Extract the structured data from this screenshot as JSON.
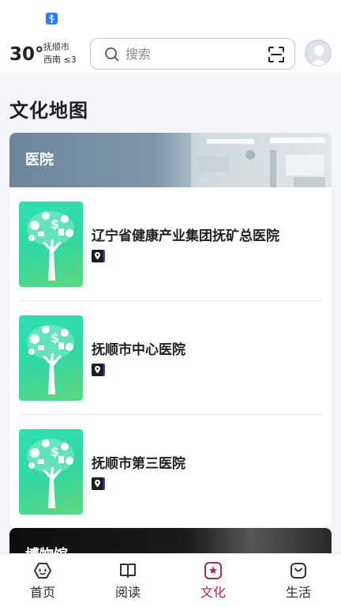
{
  "status_bar": {
    "icon": "usb-icon"
  },
  "header": {
    "temperature": "30°",
    "city": "抚顺市",
    "wind": "西南 ≤3",
    "search_placeholder": "搜索",
    "icons": [
      "search-icon",
      "scan-icon",
      "avatar"
    ]
  },
  "page_title": "文化地图",
  "category": {
    "title": "医院",
    "items": [
      {
        "name": "辽宁省健康产业集团抚矿总医院",
        "icon": "location-icon"
      },
      {
        "name": "抚顺市中心医院",
        "icon": "location-icon"
      },
      {
        "name": "抚顺市第三医院",
        "icon": "location-icon"
      }
    ]
  },
  "next_category": {
    "title": "博物馆"
  },
  "tab_bar": {
    "active_color": "#b02a4a",
    "tabs": [
      {
        "label": "首页",
        "icon": "home-icon"
      },
      {
        "label": "阅读",
        "icon": "book-icon"
      },
      {
        "label": "文化",
        "icon": "culture-star-icon",
        "active": true
      },
      {
        "label": "生活",
        "icon": "shopping-bag-icon"
      }
    ]
  }
}
